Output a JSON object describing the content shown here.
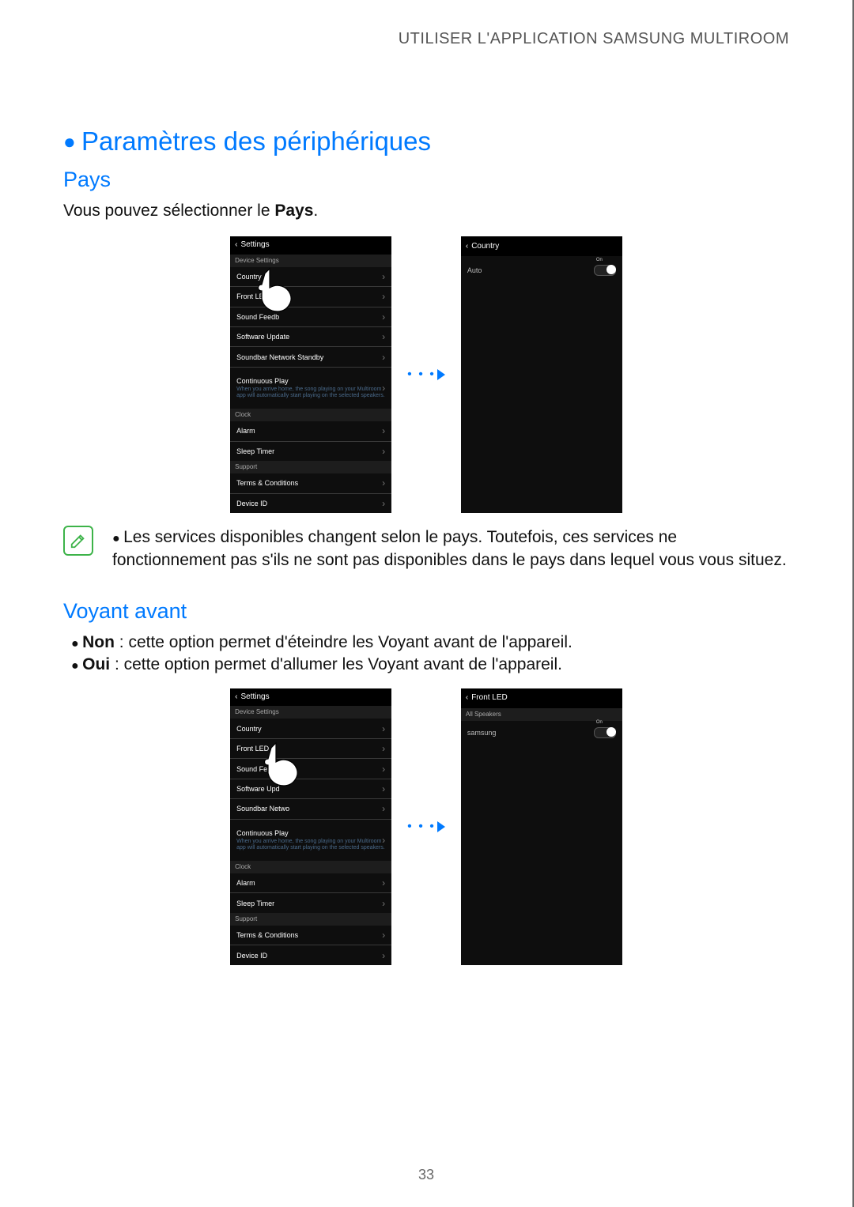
{
  "header": "UTILISER L'APPLICATION SAMSUNG MULTIROOM",
  "section_title": "Paramètres des périphériques",
  "pays": {
    "title": "Pays",
    "desc_prefix": "Vous pouvez sélectionner le ",
    "desc_bold": "Pays",
    "desc_suffix": "."
  },
  "settings_screen": {
    "back_label": "Settings",
    "section1": "Device Settings",
    "items1": [
      "Country",
      "Front LED",
      "Sound Feedb",
      "Software Update",
      "Soundbar Network Standby"
    ],
    "cont_title": "Continuous Play",
    "cont_sub": "When you arrive home, the song playing on your Multiroom app will automatically start playing on the selected speakers.",
    "section2": "Clock",
    "items2": [
      "Alarm",
      "Sleep Timer"
    ],
    "section3": "Support",
    "items3": [
      "Terms & Conditions",
      "Device ID"
    ]
  },
  "country_screen": {
    "back_label": "Country",
    "row_label": "Auto",
    "toggle_text": "On"
  },
  "note_text": "Les services disponibles changent selon le pays. Toutefois, ces services ne fonctionnement pas s'ils ne sont pas disponibles dans le pays dans lequel vous vous situez.",
  "voyant": {
    "title": "Voyant avant",
    "non_bold": "Non",
    "non_text": " : cette option permet d'éteindre les Voyant avant de l'appareil.",
    "oui_bold": "Oui",
    "oui_text": " : cette option permet d'allumer les Voyant avant de l'appareil."
  },
  "settings_screen2": {
    "back_label": "Settings",
    "section1": "Device Settings",
    "items1": [
      "Country",
      "Front LED",
      "Sound Feed",
      "Software Upd",
      "Soundbar Netwo"
    ],
    "cont_title": "Continuous Play",
    "cont_sub": "When you arrive home, the song playing on your Multiroom app will automatically start playing on the selected speakers.",
    "section2": "Clock",
    "items2": [
      "Alarm",
      "Sleep Timer"
    ],
    "section3": "Support",
    "items3": [
      "Terms & Conditions",
      "Device ID"
    ]
  },
  "frontled_screen": {
    "back_label": "Front LED",
    "section": "All Speakers",
    "row_label": "samsung",
    "toggle_text": "On"
  },
  "page_number": "33"
}
